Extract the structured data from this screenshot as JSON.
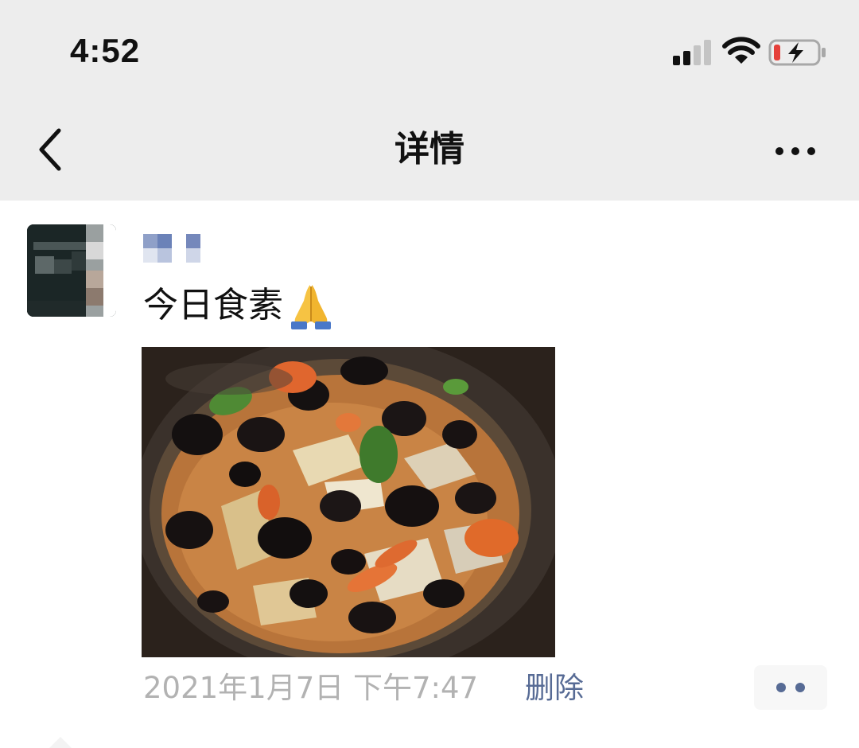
{
  "status_bar": {
    "time": "4:52",
    "signal_icon": "cellular-signal-icon",
    "wifi_icon": "wifi-icon",
    "battery_icon": "battery-low-charging-icon",
    "battery_color": "#e5403a"
  },
  "nav_bar": {
    "back_icon": "chevron-left-icon",
    "title": "详情",
    "more_icon": "more-dots-icon"
  },
  "post": {
    "text": "今日食素",
    "emoji": "🙏",
    "photo_description_icon": "food-photo",
    "timestamp": "2021年1月7日 下午7:47",
    "delete_label": "删除",
    "comment_icon": "comment-dots-icon"
  },
  "colors": {
    "nav_background": "#ededed",
    "link": "#576b95",
    "timestamp": "#b2b2b2"
  }
}
